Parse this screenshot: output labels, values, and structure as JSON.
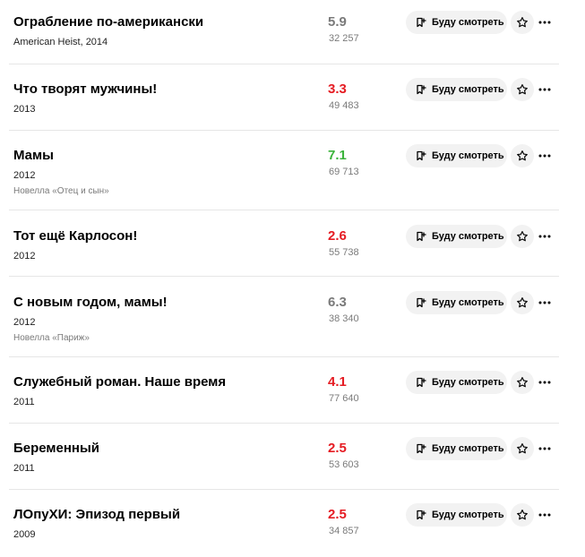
{
  "colors": {
    "rating_red": "#e51c23",
    "rating_green": "#3bb33b",
    "rating_grey": "#7a7a7a"
  },
  "watch_icon": "bookmark-plus-icon",
  "star_icon": "star-outline-icon",
  "more_icon": "more-horizontal-icon",
  "films": [
    {
      "title": "Ограбление по-американски",
      "meta": "American Heist, 2014",
      "note": "",
      "rating": "5.9",
      "rating_color": "grey",
      "votes": "32 257",
      "watch_label": "Буду смотреть"
    },
    {
      "title": "Что творят мужчины!",
      "meta": "2013",
      "note": "",
      "rating": "3.3",
      "rating_color": "red",
      "votes": "49 483",
      "watch_label": "Буду смотреть"
    },
    {
      "title": "Мамы",
      "meta": "2012",
      "note": "Новелла «Отец и сын»",
      "rating": "7.1",
      "rating_color": "green",
      "votes": "69 713",
      "watch_label": "Буду смотреть"
    },
    {
      "title": "Тот ещё Карлосон!",
      "meta": "2012",
      "note": "",
      "rating": "2.6",
      "rating_color": "red",
      "votes": "55 738",
      "watch_label": "Буду смотреть"
    },
    {
      "title": "С новым годом, мамы!",
      "meta": "2012",
      "note": "Новелла «Париж»",
      "rating": "6.3",
      "rating_color": "grey",
      "votes": "38 340",
      "watch_label": "Буду смотреть"
    },
    {
      "title": "Служебный роман. Наше время",
      "meta": "2011",
      "note": "",
      "rating": "4.1",
      "rating_color": "red",
      "votes": "77 640",
      "watch_label": "Буду смотреть"
    },
    {
      "title": "Беременный",
      "meta": "2011",
      "note": "",
      "rating": "2.5",
      "rating_color": "red",
      "votes": "53 603",
      "watch_label": "Буду смотреть"
    },
    {
      "title": "ЛОпуХИ: Эпизод первый",
      "meta": "2009",
      "note": "",
      "rating": "2.5",
      "rating_color": "red",
      "votes": "34 857",
      "watch_label": "Буду смотреть"
    }
  ]
}
